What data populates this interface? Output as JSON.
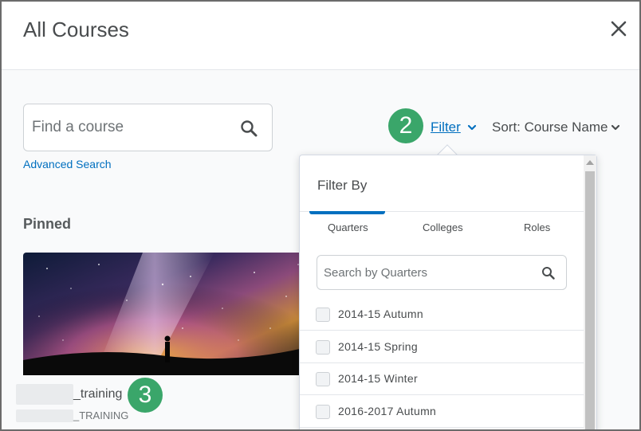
{
  "dialog": {
    "title": "All Courses"
  },
  "search": {
    "placeholder": "Find a course",
    "advanced_label": "Advanced Search"
  },
  "toolbar": {
    "filter_label": "Filter",
    "sort_label": "Sort: Course Name"
  },
  "callouts": {
    "step2": "2",
    "step3": "3"
  },
  "pinned": {
    "heading": "Pinned",
    "course": {
      "name": "_training",
      "code": "_TRAINING"
    }
  },
  "filter_panel": {
    "heading": "Filter By",
    "tabs": [
      {
        "label": "Quarters",
        "active": true
      },
      {
        "label": "Colleges",
        "active": false
      },
      {
        "label": "Roles",
        "active": false
      }
    ],
    "search_placeholder": "Search by Quarters",
    "options": [
      {
        "label": "2014-15 Autumn",
        "checked": false
      },
      {
        "label": "2014-15 Spring",
        "checked": false
      },
      {
        "label": "2014-15 Winter",
        "checked": false
      },
      {
        "label": "2016-2017 Autumn",
        "checked": false
      }
    ]
  },
  "colors": {
    "link": "#006fbf",
    "badge": "#3aa66a",
    "text": "#494c4e"
  },
  "icons": {
    "close": "close-icon",
    "search": "search-icon",
    "chevron": "chevron-down-icon"
  }
}
